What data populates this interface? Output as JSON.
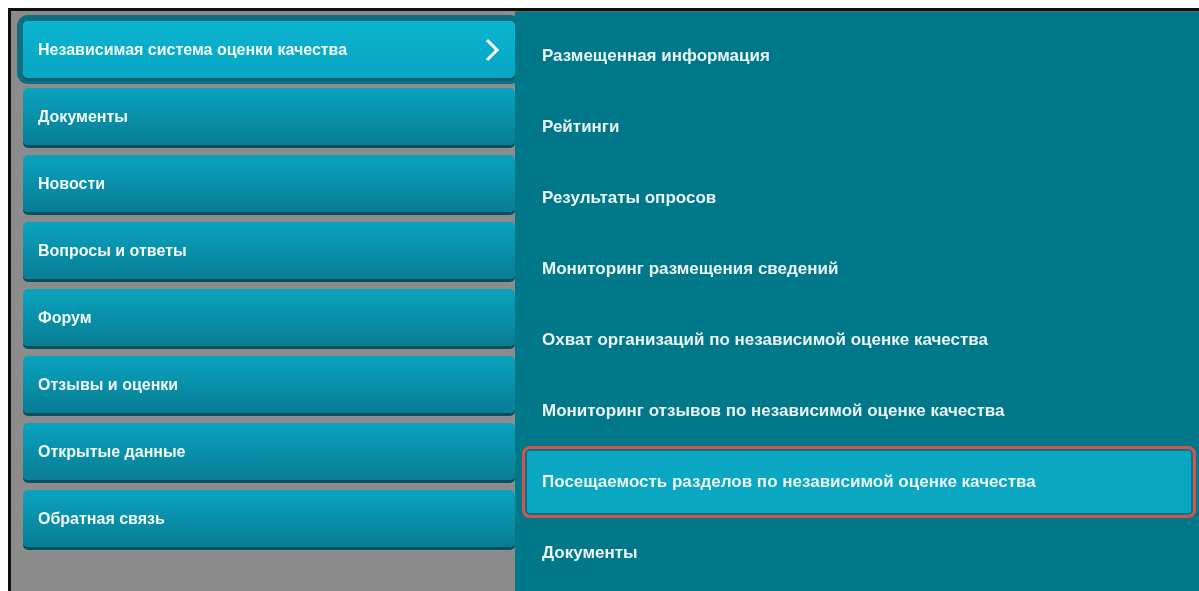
{
  "main_menu": [
    {
      "label": "Независимая система оценки качества",
      "selected": true,
      "has_submenu": true
    },
    {
      "label": "Документы",
      "selected": false,
      "has_submenu": false
    },
    {
      "label": "Новости",
      "selected": false,
      "has_submenu": false
    },
    {
      "label": "Вопросы и ответы",
      "selected": false,
      "has_submenu": false
    },
    {
      "label": "Форум",
      "selected": false,
      "has_submenu": false
    },
    {
      "label": "Отзывы и оценки",
      "selected": false,
      "has_submenu": false
    },
    {
      "label": "Открытые данные",
      "selected": false,
      "has_submenu": false
    },
    {
      "label": "Обратная связь",
      "selected": false,
      "has_submenu": false
    }
  ],
  "submenu": [
    {
      "label": "Размещенная информация",
      "selected": false
    },
    {
      "label": "Рейтинги",
      "selected": false
    },
    {
      "label": "Результаты опросов",
      "selected": false
    },
    {
      "label": "Мониторинг размещения сведений",
      "selected": false
    },
    {
      "label": "Охват организаций по независимой оценке качества",
      "selected": false
    },
    {
      "label": "Мониторинг отзывов по независимой оценке качества",
      "selected": false
    },
    {
      "label": "Посещаемость разделов по независимой оценке качества",
      "selected": true
    },
    {
      "label": "Документы",
      "selected": false
    }
  ]
}
